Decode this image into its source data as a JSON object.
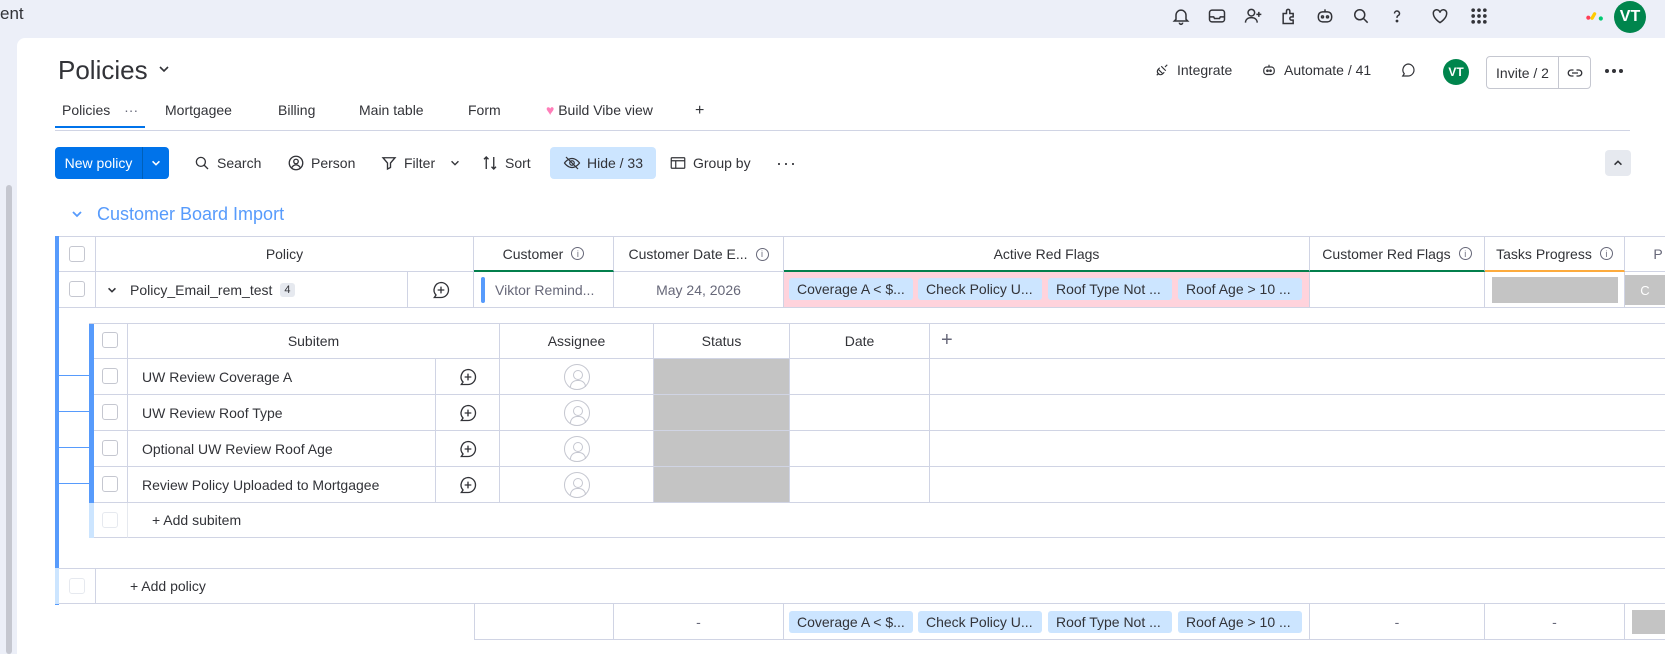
{
  "topbar": {
    "brand_text": "ent",
    "avatar_initials": "VT",
    "icons": [
      "bell-icon",
      "inbox-icon",
      "invite-members-icon",
      "apps-icon",
      "ai-assistant-icon",
      "search-icon",
      "help-icon",
      "heart-icon",
      "app-grid-icon",
      "monday-logo-icon"
    ]
  },
  "header": {
    "board_title": "Policies",
    "integrate": "Integrate",
    "automate": "Automate / 41",
    "avatar": "VT",
    "invite": "Invite / 2"
  },
  "tabs": [
    {
      "label": "Policies"
    },
    {
      "label": "Mortgagee"
    },
    {
      "label": "Billing"
    },
    {
      "label": "Main table"
    },
    {
      "label": "Form"
    },
    {
      "label": "Build Vibe view"
    }
  ],
  "tab_add": "+",
  "toolbar": {
    "new_item": "New policy",
    "search": "Search",
    "person": "Person",
    "filter": "Filter",
    "sort": "Sort",
    "hide": "Hide / 33",
    "group_by": "Group by",
    "more": "···"
  },
  "group": {
    "title": "Customer Board Import",
    "color": "#579bfc",
    "columns": {
      "policy": "Policy",
      "customer": "Customer",
      "customer_date": "Customer Date E...",
      "active_flags": "Active Red Flags",
      "customer_flags": "Customer Red Flags",
      "tasks_progress": "Tasks Progress"
    },
    "row": {
      "name": "Policy_Email_rem_test",
      "subitem_count": "4",
      "customer": "Viktor Remind...",
      "date": "May 24, 2026",
      "flags": [
        "Coverage A < $...",
        "Check Policy U...",
        "Roof Type Not ...",
        "Roof Age > 10 ..."
      ],
      "next_col_partial": "C"
    },
    "subitems": {
      "columns": {
        "name": "Subitem",
        "assignee": "Assignee",
        "status": "Status",
        "date": "Date",
        "add": "+"
      },
      "items": [
        {
          "name": "UW Review Coverage A"
        },
        {
          "name": "UW Review Roof Type"
        },
        {
          "name": "Optional UW Review Roof Age"
        },
        {
          "name": "Review Policy Uploaded to Mortgagee"
        }
      ],
      "add_label": "+ Add subitem"
    },
    "add_item": "+ Add policy",
    "summary": {
      "date": "-",
      "flags": [
        "Coverage A < $...",
        "Check Policy U...",
        "Roof Type Not ...",
        "Roof Age > 10 ..."
      ],
      "customer_flags": "-",
      "tasks": "-"
    }
  },
  "colors": {
    "primary": "#0073ea",
    "flag_bg": "#cce5ff",
    "red_flag_area": "#ffd3dc",
    "status_gray": "#c4c4c4",
    "avatar_green": "#00854d"
  }
}
